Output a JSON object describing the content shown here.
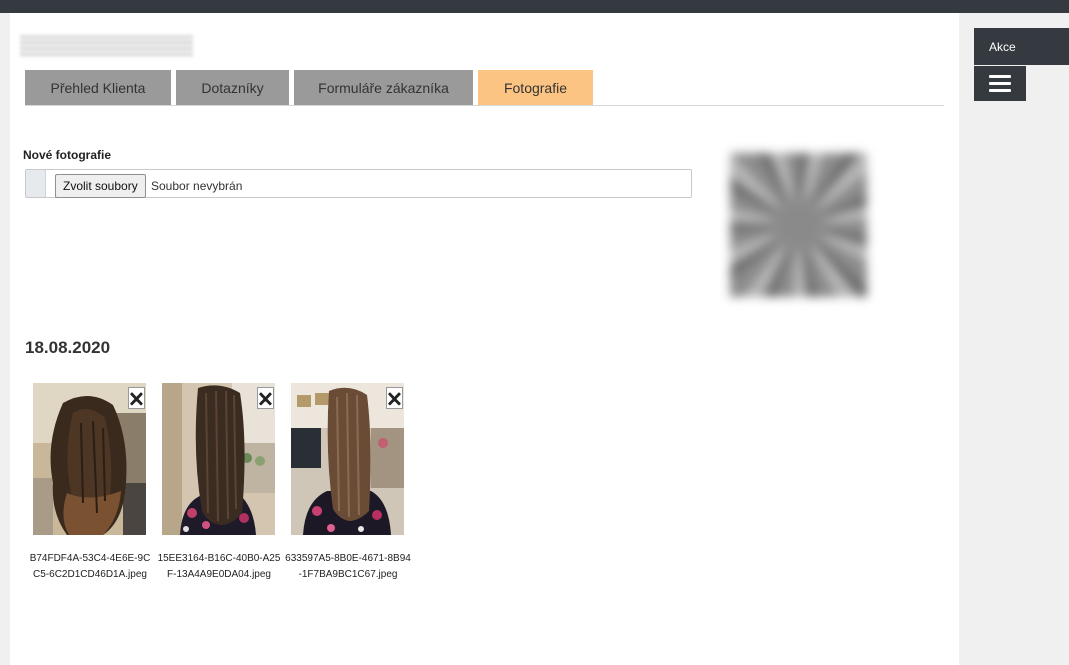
{
  "tabs": [
    {
      "label": "Přehled Klienta",
      "active": false
    },
    {
      "label": "Dotazníky",
      "active": false
    },
    {
      "label": "Formuláře zákazníka",
      "active": false
    },
    {
      "label": "Fotografie",
      "active": true
    }
  ],
  "upload": {
    "label": "Nové fotografie",
    "button_label": "Zvolit soubory",
    "status": "Soubor nevybrán"
  },
  "gallery": {
    "date": "18.08.2020",
    "delete_glyph": "🗙",
    "photos": [
      {
        "filename": "B74FDF4A-53C4-4E6E-9CC5-6C2D1CD46D1A.jpeg",
        "icon": "hair-before-photo"
      },
      {
        "filename": "15EE3164-B16C-40B0-A25F-13A4A9E0DA04.jpeg",
        "icon": "hair-after-photo"
      },
      {
        "filename": "633597A5-8B0E-4671-8B94-1F7BA9BC1C67.jpeg",
        "icon": "hair-after-photo"
      }
    ]
  },
  "sidebar": {
    "actions_label": "Akce",
    "menu_icon": "hamburger-menu-icon"
  },
  "colors": {
    "active_tab": "#fcc482",
    "inactive_tab": "#9a9a9a",
    "dark": "#343a40"
  }
}
